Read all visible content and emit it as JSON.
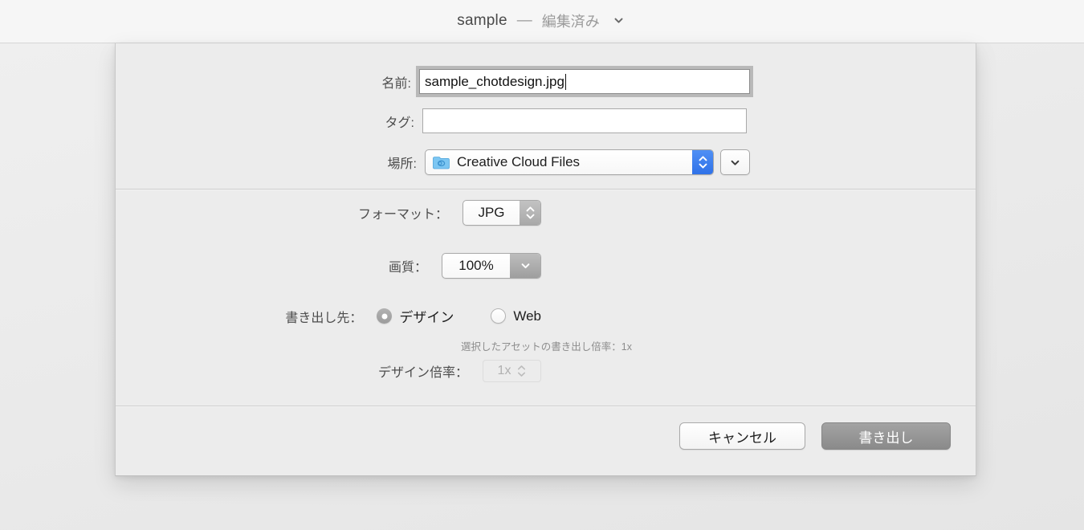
{
  "window": {
    "title_name": "sample",
    "title_separator": "—",
    "title_state": "編集済み",
    "title_chevron_icon": "chevron-down-icon"
  },
  "sheet": {
    "name_row": {
      "label": "名前:",
      "value": "sample_chotdesign.jpg",
      "placeholder": ""
    },
    "tags_row": {
      "label": "タグ:",
      "value": "",
      "placeholder": ""
    },
    "location_row": {
      "label": "場所:",
      "value": "Creative Cloud Files",
      "folder_icon": "creative-cloud-folder-icon",
      "stepper_icon": "updown-chevron-icon",
      "expand_icon": "chevron-down-icon"
    },
    "format_row": {
      "label": "フォーマット：",
      "value": "JPG",
      "stepper_icon": "updown-chevron-icon"
    },
    "quality_row": {
      "label": "画質：",
      "value": "100%",
      "pulldown_icon": "chevron-down-icon"
    },
    "export_target_row": {
      "label": "書き出し先：",
      "options": [
        {
          "label": "デザイン",
          "selected": true
        },
        {
          "label": "Web",
          "selected": false
        }
      ],
      "helper_text": "選択したアセットの書き出し倍率：1x"
    },
    "scale_row": {
      "label": "デザイン倍率：",
      "value": "1x",
      "disabled": true,
      "stepper_icon": "updown-chevron-icon"
    },
    "buttons": {
      "cancel": "キャンセル",
      "confirm": "書き出し"
    }
  },
  "colors": {
    "sheet_bg": "#ececec",
    "titlebar_bg": "#f6f6f6",
    "accent_blue": "#2f72e8",
    "default_button": "#8a8a8a",
    "folder_blue": "#6cbcf0"
  }
}
